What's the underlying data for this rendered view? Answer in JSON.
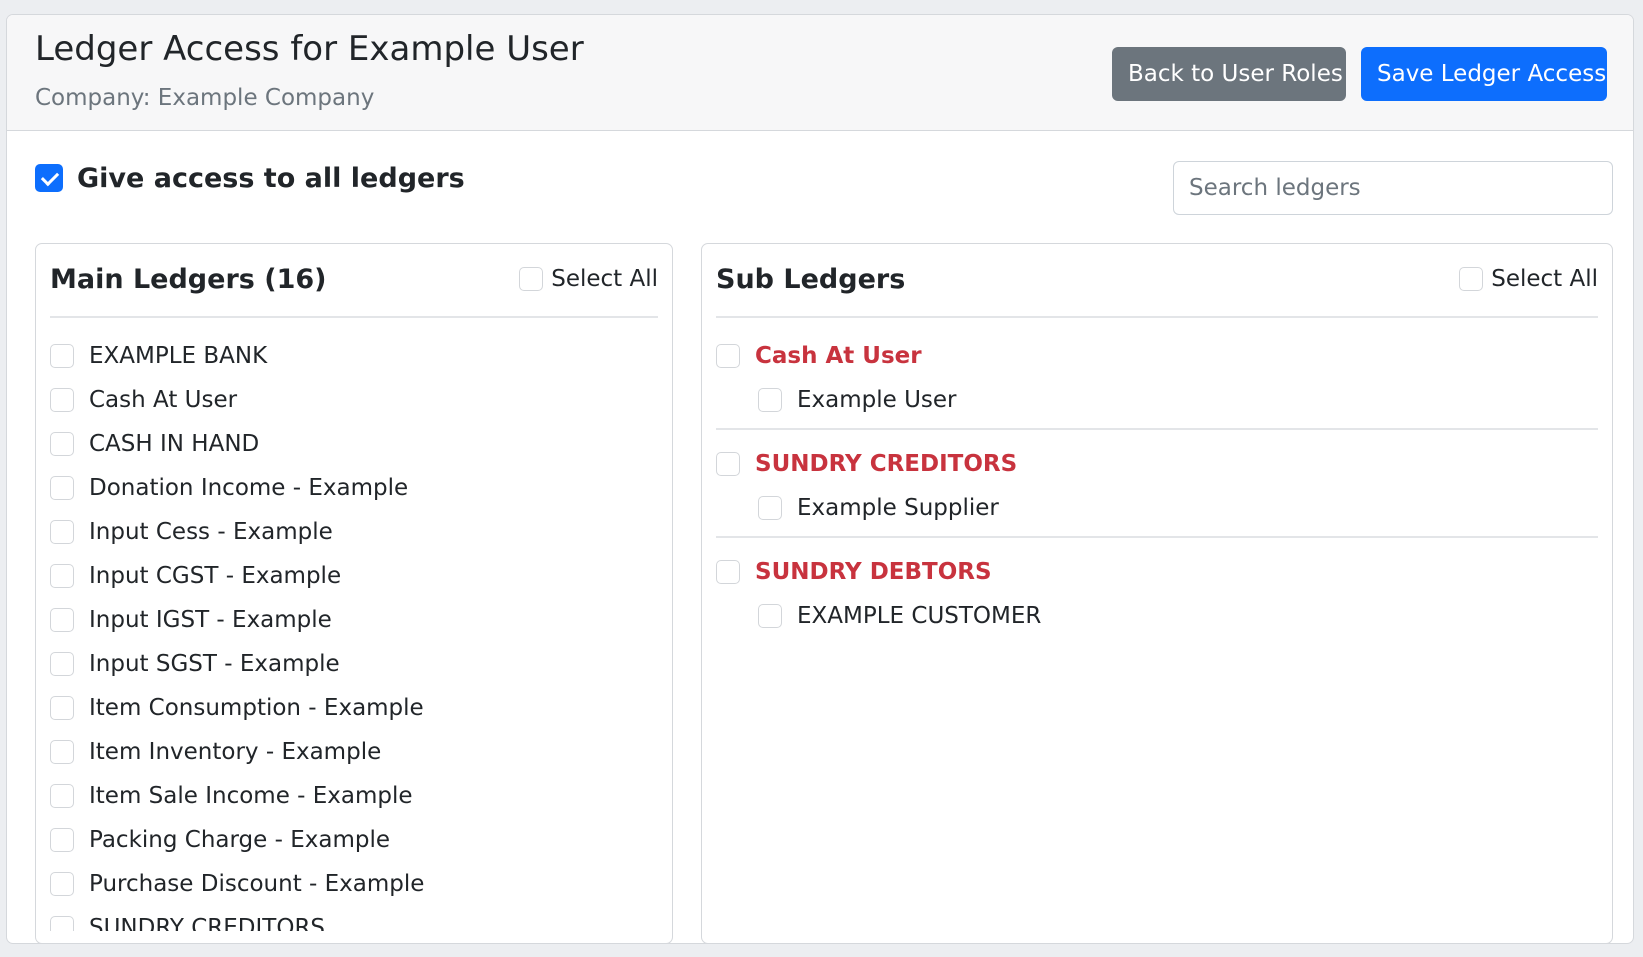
{
  "header": {
    "title": "Ledger Access for Example User",
    "company": "Company: Example Company",
    "back_button": "Back to User Roles",
    "save_button": "Save Ledger Access"
  },
  "all_access": {
    "label": "Give access to all ledgers",
    "checked": true
  },
  "search": {
    "placeholder": "Search ledgers",
    "value": ""
  },
  "main_ledgers": {
    "title": "Main Ledgers (16)",
    "select_all_label": "Select All",
    "items": [
      "EXAMPLE BANK",
      "Cash At User",
      "CASH IN HAND",
      "Donation Income - Example",
      "Input Cess - Example",
      "Input CGST - Example",
      "Input IGST - Example",
      "Input SGST - Example",
      "Item Consumption - Example",
      "Item Inventory - Example",
      "Item Sale Income - Example",
      "Packing Charge - Example",
      "Purchase Discount - Example",
      "SUNDRY CREDITORS"
    ]
  },
  "sub_ledgers": {
    "title": "Sub Ledgers",
    "select_all_label": "Select All",
    "groups": [
      {
        "name": "Cash At User",
        "bold": false,
        "children": [
          "Example User"
        ]
      },
      {
        "name": "SUNDRY CREDITORS",
        "bold": true,
        "children": [
          "Example Supplier"
        ]
      },
      {
        "name": "SUNDRY DEBTORS",
        "bold": true,
        "children": [
          "EXAMPLE CUSTOMER"
        ]
      }
    ]
  },
  "colors": {
    "primary": "#0d6efd",
    "secondary": "#6c757d",
    "group_label": "#c8333e"
  }
}
